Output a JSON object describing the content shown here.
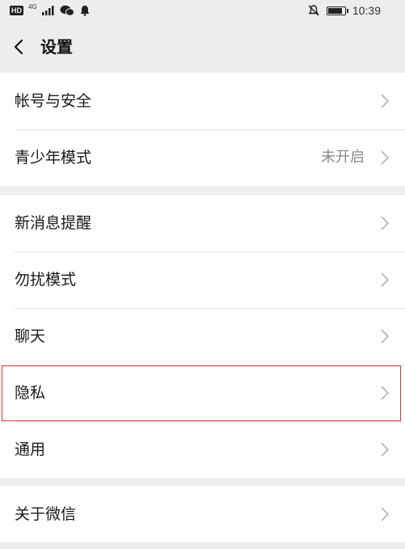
{
  "status_bar": {
    "hd": "HD",
    "network": "4G",
    "time": "10:39"
  },
  "header": {
    "back_icon": "chevron-left-icon",
    "title": "设置"
  },
  "settings": {
    "group1": [
      {
        "label": "帐号与安全",
        "value": ""
      },
      {
        "label": "青少年模式",
        "value": "未开启"
      }
    ],
    "group2": [
      {
        "label": "新消息提醒",
        "value": ""
      },
      {
        "label": "勿扰模式",
        "value": ""
      },
      {
        "label": "聊天",
        "value": ""
      },
      {
        "label": "隐私",
        "value": "",
        "highlighted": true
      },
      {
        "label": "通用",
        "value": ""
      }
    ],
    "group3": [
      {
        "label": "关于微信",
        "value": ""
      }
    ]
  },
  "colors": {
    "background": "#ededed",
    "row_background": "#ffffff",
    "highlight_border": "#d9333d",
    "value_text": "#8a8a8a"
  }
}
